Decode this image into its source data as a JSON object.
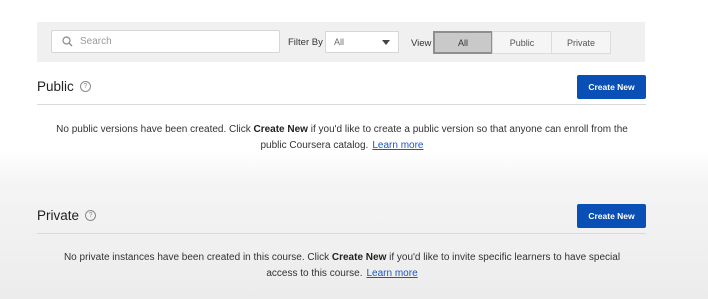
{
  "filters": {
    "search_placeholder": "Search",
    "filter_by_label": "Filter By",
    "filter_by_value": "All",
    "view_label": "View",
    "view_options": [
      "All",
      "Public",
      "Private"
    ],
    "view_selected": "All"
  },
  "public_section": {
    "title": "Public",
    "create_label": "Create New",
    "message_before": "No public versions have been created. Click ",
    "message_bold": "Create New",
    "message_after": " if you'd like to create a public version so that anyone can enroll from the public Coursera catalog.",
    "learn_more": "Learn more"
  },
  "private_section": {
    "title": "Private",
    "create_label": "Create New",
    "message_before": "No private instances have been created in this course. Click ",
    "message_bold": "Create New",
    "message_after": " if you'd like to invite specific learners to have special access to this course.",
    "learn_more": "Learn more"
  },
  "colors": {
    "primary_button": "#0a4fb5",
    "link": "#1a56c4",
    "filter_bar_bg": "#f0f0f0",
    "active_toggle": "#c9c9c9"
  }
}
